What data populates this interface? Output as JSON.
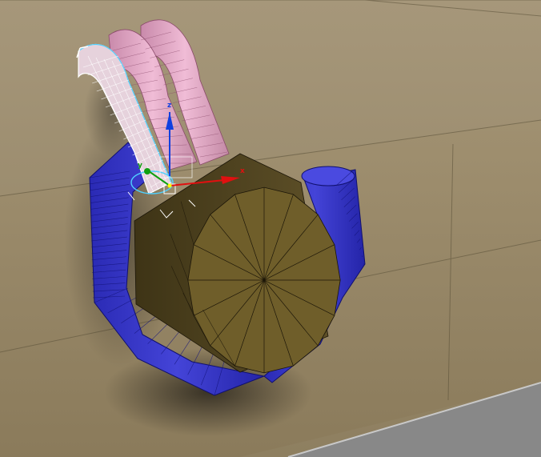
{
  "viewport": {
    "label": "3D viewport",
    "colors": {
      "wall": "#9b8c6c",
      "floor": "#a08f6e",
      "edge": "#564c38",
      "blue": "#3232c8",
      "blue_dark": "#1e1e8c",
      "blue_light": "#5050e0",
      "pink": "#e2a6c4",
      "pink_light": "#f2c4dc",
      "selected": "#d8c8d0",
      "cylinder_face": "#6e5d28",
      "cylinder_side": "#4e4220",
      "cylinder_wire": "#1c1608",
      "gizmo_x": "#e01010",
      "gizmo_y": "#10a010",
      "gizmo_z": "#1040e0",
      "panel": "#7a7a7a"
    }
  },
  "gizmo": {
    "x_label": "x",
    "y_label": "y",
    "z_label": "z"
  }
}
